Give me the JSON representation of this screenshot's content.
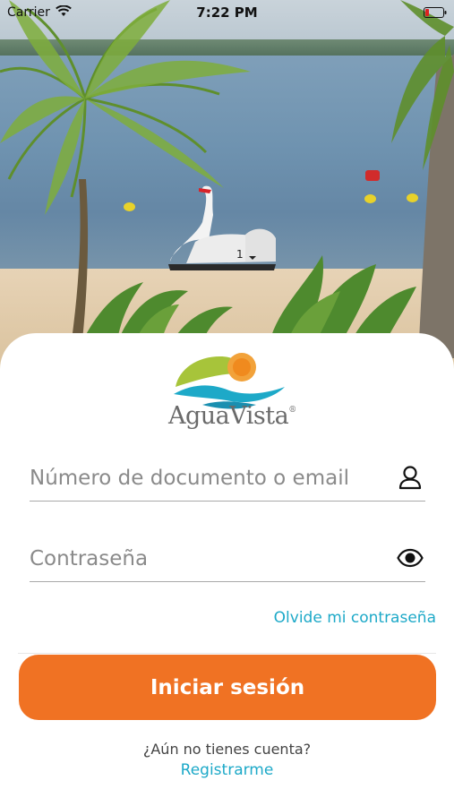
{
  "status_bar": {
    "carrier": "Carrier",
    "time": "7:22 PM",
    "wifi_icon": "wifi-icon",
    "battery_icon": "battery-icon"
  },
  "background": {
    "description_icon": "beach-photo"
  },
  "brand": {
    "name": "AguaVista",
    "registered_mark": "®",
    "colors": {
      "sun": "#f2a23a",
      "leaf": "#a7c43a",
      "wave": "#1da9c8",
      "text": "#6a6a6a"
    }
  },
  "login": {
    "username_placeholder": "Número de documento o email",
    "username_value": "",
    "username_icon": "user-icon",
    "password_placeholder": "Contraseña",
    "password_value": "",
    "password_icon": "eye-icon",
    "forgot_label": "Olvide mi contraseña",
    "submit_label": "Iniciar sesión",
    "no_account_text": "¿Aún no tienes cuenta?",
    "register_label": "Registrarme"
  },
  "colors": {
    "accent": "#f07223",
    "link": "#1da9c8"
  }
}
